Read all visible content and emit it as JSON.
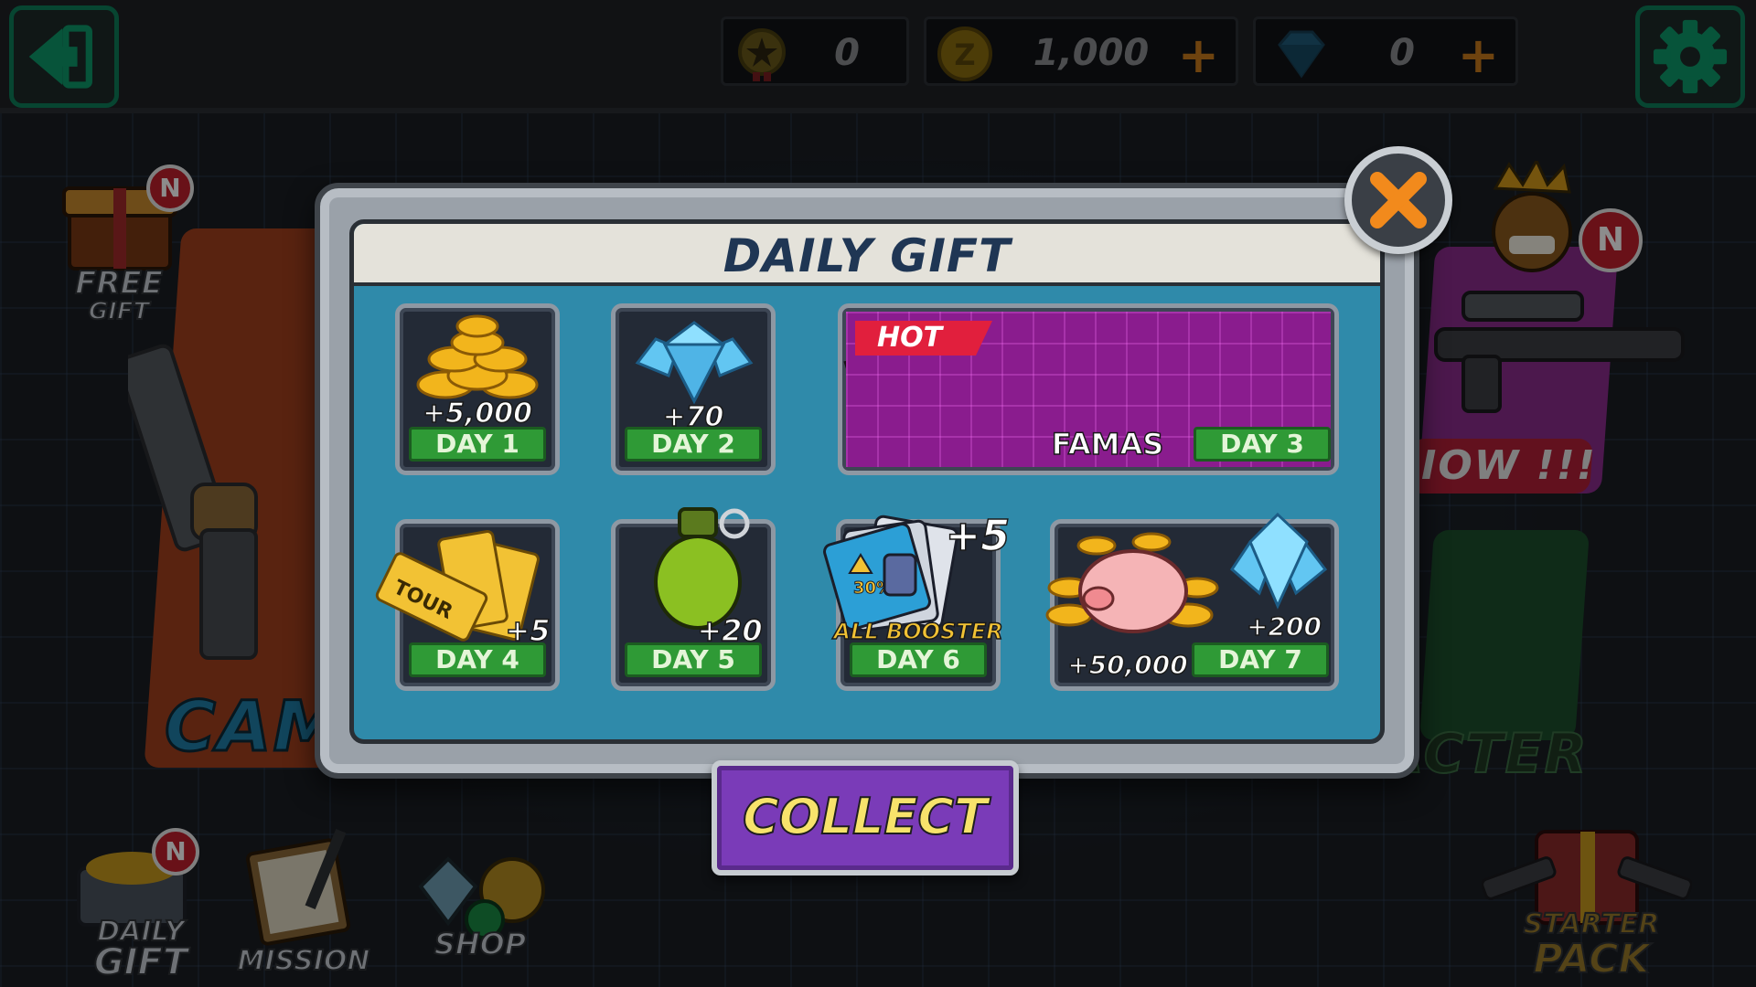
{
  "topbar": {
    "medals": "0",
    "coins": "1,000",
    "gems": "0",
    "coin_plus": "+",
    "gem_plus": "+"
  },
  "side": {
    "free_gift": "FREE",
    "free_gift_2": "GIFT",
    "free_gift_badge": "N",
    "right_badge": "N",
    "campaign_label": "CAM",
    "buy_now_label": "IOW !!!",
    "character_label": "ACTER"
  },
  "bottom_nav": {
    "daily_gift_1": "DAILY",
    "daily_gift_2": "GIFT",
    "daily_gift_badge": "N",
    "mission": "MISSION",
    "shop": "SHOP",
    "starter_1": "STARTER",
    "starter_2": "PACK"
  },
  "popup": {
    "title": "DAILY GIFT",
    "rewards": [
      {
        "day": "DAY 1",
        "amount": "+5,000"
      },
      {
        "day": "DAY 2",
        "amount": "+70"
      },
      {
        "day": "DAY 3",
        "hot": "HOT",
        "name": "FAMAS"
      },
      {
        "day": "DAY 4",
        "amount": "+5",
        "ticket_text": "TOUR"
      },
      {
        "day": "DAY 5",
        "amount": "+20"
      },
      {
        "day": "DAY 6",
        "amount": "+5",
        "name": "ALL BOOSTER",
        "percent": "30%"
      },
      {
        "day": "DAY 7",
        "amount": "+50,000",
        "amount2": "+200"
      }
    ],
    "collect": "COLLECT"
  },
  "colors": {
    "accent_green": "#0d7e5a",
    "popup_blue": "#2f8aaa",
    "day_green": "#2f9a36",
    "collect_purple": "#7a3bb8",
    "collect_text": "#f7e36b",
    "hot_red": "#e11f3d",
    "close_orange": "#f28a1c"
  },
  "icons": [
    "back-icon",
    "medal-icon",
    "coin-icon",
    "gem-icon",
    "gear-icon",
    "close-icon"
  ]
}
